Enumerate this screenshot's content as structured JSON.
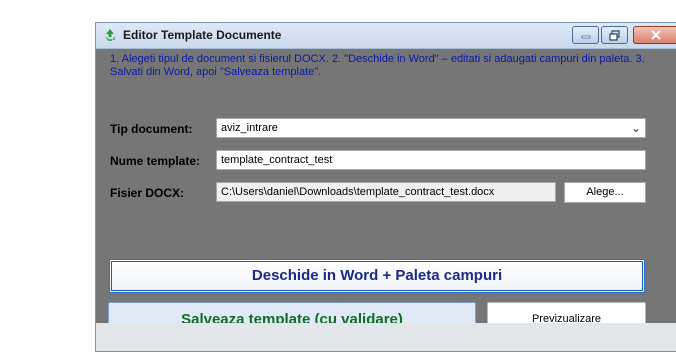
{
  "window": {
    "title": "Editor Template Documente",
    "icon": "recycle-icon"
  },
  "instructions": "1. Alegeti tipul de document si fisierul DOCX.  2. \"Deschide in Word\" – editati si adaugati campuri din paleta.  3. Salvati din Word, apoi \"Salveaza template\".",
  "form": {
    "tip_document": {
      "label": "Tip document:",
      "value": "aviz_intrare"
    },
    "nume_template": {
      "label": "Nume template:",
      "value": "template_contract_test"
    },
    "fisier_docx": {
      "label": "Fisier DOCX:",
      "value": "C:\\Users\\daniel\\Downloads\\template_contract_test.docx",
      "browse_label": "Alege..."
    }
  },
  "buttons": {
    "open_word": "Deschide in Word + Paleta campuri",
    "save": "Salveaza template (cu validare)",
    "preview": "Previzualizare"
  },
  "colors": {
    "instructions": "#0a1aa8",
    "open_word_text": "#1a2a86",
    "save_text": "#116b2a",
    "client_bg": "#767676"
  }
}
